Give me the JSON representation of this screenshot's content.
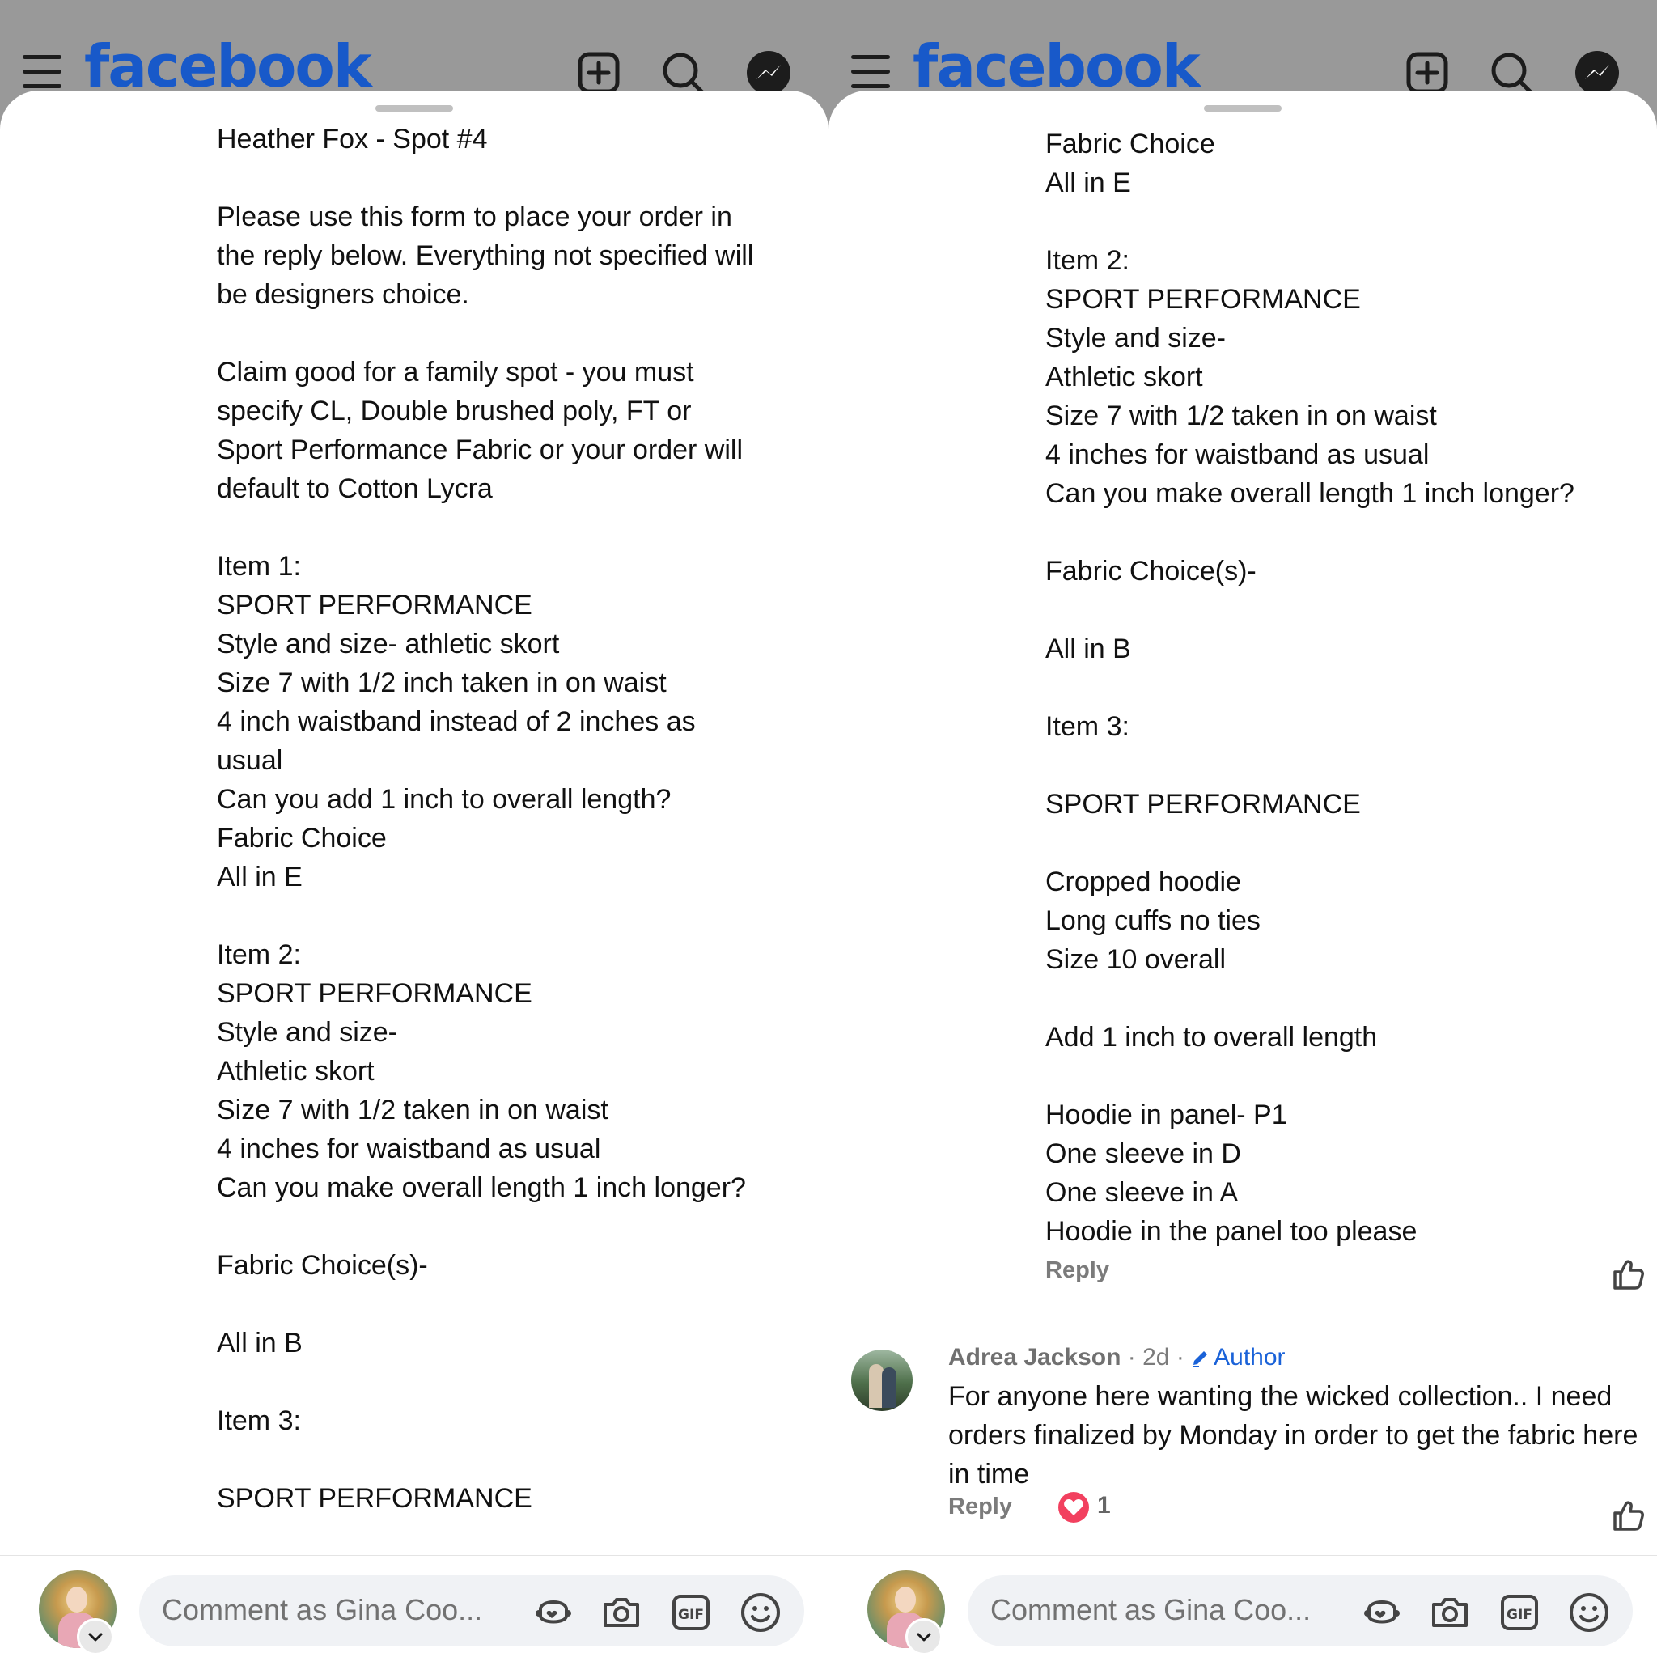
{
  "app": {
    "brand": "facebook",
    "colors": {
      "brand": "#1859c9",
      "author": "#1a62d8",
      "reaction": "#f2405f"
    },
    "toolbar_icons": [
      "menu-icon",
      "create-icon",
      "search-icon",
      "messenger-icon"
    ]
  },
  "left_panel": {
    "post_text": "Heather Fox - Spot #4\n\nPlease use this form to place your order in\nthe reply below. Everything not specified will\nbe designers choice.\n\nClaim good for a family spot - you must\nspecify CL, Double brushed poly, FT or\nSport Performance Fabric or your order will\ndefault to Cotton Lycra\n\nItem 1:\nSPORT PERFORMANCE\nStyle and size- athletic skort\nSize 7 with 1/2 inch taken in on waist\n4 inch waistband instead of 2 inches as\nusual\nCan you add 1 inch to overall length?\nFabric Choice\nAll in E\n\nItem 2:\nSPORT PERFORMANCE\nStyle and size-\nAthletic skort\nSize 7 with 1/2 taken in on waist\n4 inches for waistband as usual\nCan you make overall length 1 inch longer?\n\nFabric Choice(s)-\n\nAll in B\n\nItem 3:\n\nSPORT PERFORMANCE"
  },
  "right_panel": {
    "post_text": "Fabric Choice\nAll in E\n\nItem 2:\nSPORT PERFORMANCE\nStyle and size-\nAthletic skort\nSize 7 with 1/2 taken in on waist\n4 inches for waistband as usual\nCan you make overall length 1 inch longer?\n\nFabric Choice(s)-\n\nAll in B\n\nItem 3:\n\nSPORT PERFORMANCE\n\nCropped hoodie\nLong cuffs no ties\nSize 10 overall\n\nAdd 1 inch to overall length\n\nHoodie in panel- P1\nOne sleeve in D\nOne sleeve in A\nHoodie in the panel too please",
    "reply_label": "Reply",
    "comment": {
      "author": "Adrea Jackson",
      "meta": " · 2d · ",
      "badge": "Author",
      "body": "For anyone here wanting the wicked collection.. I need orders finalized by Monday in order to get the fabric here in time",
      "reply_label": "Reply",
      "reaction_icon": "heart-reaction-icon",
      "reaction_count": "1"
    }
  },
  "composer": {
    "placeholder": "Comment as Gina Coo...",
    "icons": [
      "avatar-sticker-icon",
      "camera-icon",
      "gif-icon",
      "emoji-icon"
    ]
  }
}
